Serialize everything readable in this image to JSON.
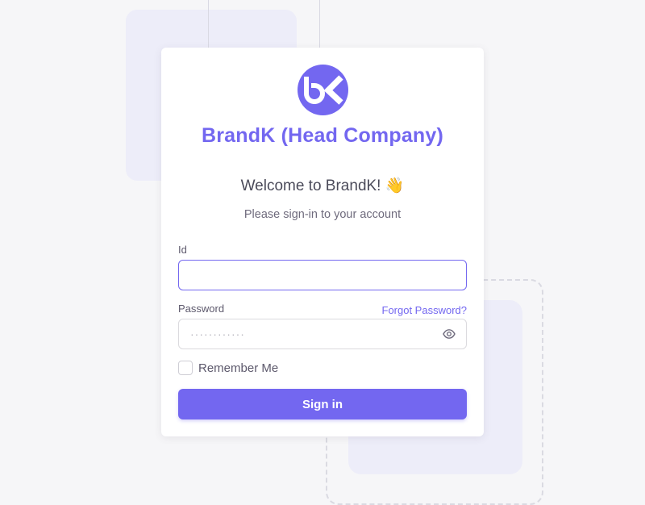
{
  "brand": {
    "name": "BrandK (Head Company)",
    "logo_icon": "bk-logo",
    "accent_color": "#7367f0"
  },
  "welcome": {
    "title": "Welcome to BrandK!",
    "emoji": "👋",
    "subtitle": "Please sign-in to your account"
  },
  "form": {
    "id_label": "Id",
    "id_value": "",
    "password_label": "Password",
    "password_placeholder": "············",
    "forgot_password": "Forgot Password?",
    "show_password_icon": "eye-icon",
    "remember_me": "Remember Me",
    "remember_checked": false,
    "submit_label": "Sign in"
  }
}
